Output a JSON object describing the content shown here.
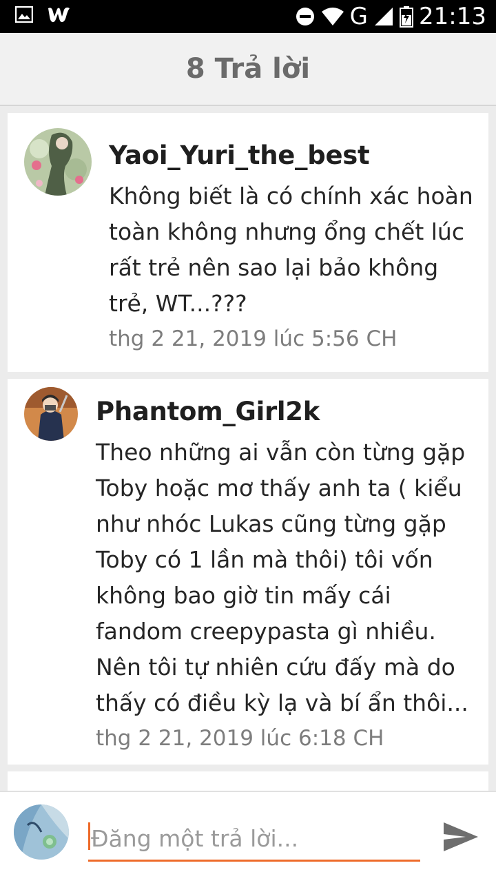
{
  "status_bar": {
    "time": "21:13",
    "network": "G",
    "icons": [
      "image-icon",
      "wattpad-logo-icon",
      "do-not-disturb-icon",
      "wifi-icon",
      "signal-icon",
      "battery-icon"
    ]
  },
  "header": {
    "title": "8 Trả lời"
  },
  "comments": [
    {
      "username": "Yaoi_Yuri_the_best",
      "text": "Không biết là có chính xác hoàn toàn không nhưng ổng chết lúc rất trẻ nên sao lại bảo không trẻ, WT...???",
      "timestamp": "thg 2 21, 2019 lúc 5:56 CH"
    },
    {
      "username": "Phantom_Girl2k",
      "text": "Theo những ai vẫn còn từng gặp Toby hoặc mơ thấy anh ta ( kiểu như nhóc Lukas cũng từng gặp Toby có 1 lần mà thôi) tôi vốn không bao giờ tin mấy cái fandom creepypasta gì nhiều. Nên tôi tự nhiên cứu đấy mà do thấy có điều kỳ lạ và bí ẩn thôi...",
      "timestamp": "thg 2 21, 2019 lúc 6:18 CH"
    }
  ],
  "composer": {
    "placeholder": "Đăng một trả lời..."
  },
  "colors": {
    "accent": "#ee6b2a",
    "header_bg": "#f1f1f1",
    "page_bg": "#ececec"
  }
}
